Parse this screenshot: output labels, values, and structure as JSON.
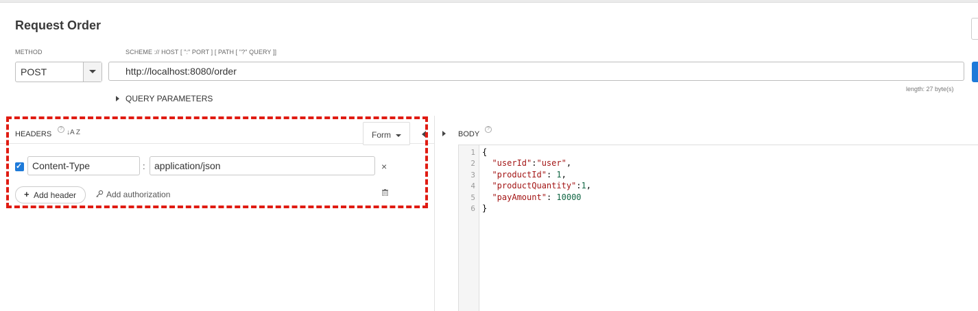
{
  "request": {
    "title": "Request Order",
    "method_label": "METHOD",
    "method": "POST",
    "url_label": "SCHEME :// HOST [ \":\" PORT ] [ PATH [ \"?\" QUERY ]]",
    "url": "http://localhost:8080/order",
    "length_label": "length: 27 byte(s)"
  },
  "query_parameters": {
    "label": "QUERY PARAMETERS"
  },
  "headers": {
    "label": "HEADERS",
    "help_glyph": "?",
    "sort_glyph": "↓A Z",
    "mode": "Form",
    "rows": [
      {
        "enabled": true,
        "name": "Content-Type",
        "separator": ":",
        "value": "application/json",
        "remove_glyph": "×"
      }
    ],
    "add_header_glyph": "+",
    "add_header_label": "Add header",
    "add_authorization_label": "Add authorization",
    "icons": [
      "help-icon",
      "sort-icon",
      "caret-down-icon",
      "collapse-arrow-icon",
      "checkbox-icon",
      "close-icon",
      "plus-icon",
      "key-icon",
      "trash-icon"
    ]
  },
  "body": {
    "label": "BODY",
    "help_glyph": "?",
    "line_numbers": [
      "1",
      "2",
      "3",
      "4",
      "5",
      "6"
    ],
    "lines": [
      {
        "parts": [
          {
            "t": "{",
            "c": "p"
          }
        ]
      },
      {
        "parts": [
          {
            "t": "  ",
            "c": "p"
          },
          {
            "t": "\"userId\"",
            "c": "k"
          },
          {
            "t": ":",
            "c": "p"
          },
          {
            "t": "\"user\"",
            "c": "k"
          },
          {
            "t": ",",
            "c": "p"
          }
        ]
      },
      {
        "parts": [
          {
            "t": "  ",
            "c": "p"
          },
          {
            "t": "\"productId\"",
            "c": "k"
          },
          {
            "t": ": ",
            "c": "p"
          },
          {
            "t": "1",
            "c": "n"
          },
          {
            "t": ",",
            "c": "p"
          }
        ]
      },
      {
        "parts": [
          {
            "t": "  ",
            "c": "p"
          },
          {
            "t": "\"productQuantity\"",
            "c": "k"
          },
          {
            "t": ":",
            "c": "p"
          },
          {
            "t": "1",
            "c": "n"
          },
          {
            "t": ",",
            "c": "p"
          }
        ]
      },
      {
        "parts": [
          {
            "t": "  ",
            "c": "p"
          },
          {
            "t": "\"payAmount\"",
            "c": "k"
          },
          {
            "t": ": ",
            "c": "p"
          },
          {
            "t": "10000",
            "c": "n"
          }
        ]
      },
      {
        "parts": [
          {
            "t": "}",
            "c": "p"
          }
        ]
      }
    ]
  },
  "colors": {
    "accent": "#1e7ad9",
    "annotation": "#e01b12",
    "json_key": "#a31515",
    "json_number": "#116644"
  }
}
